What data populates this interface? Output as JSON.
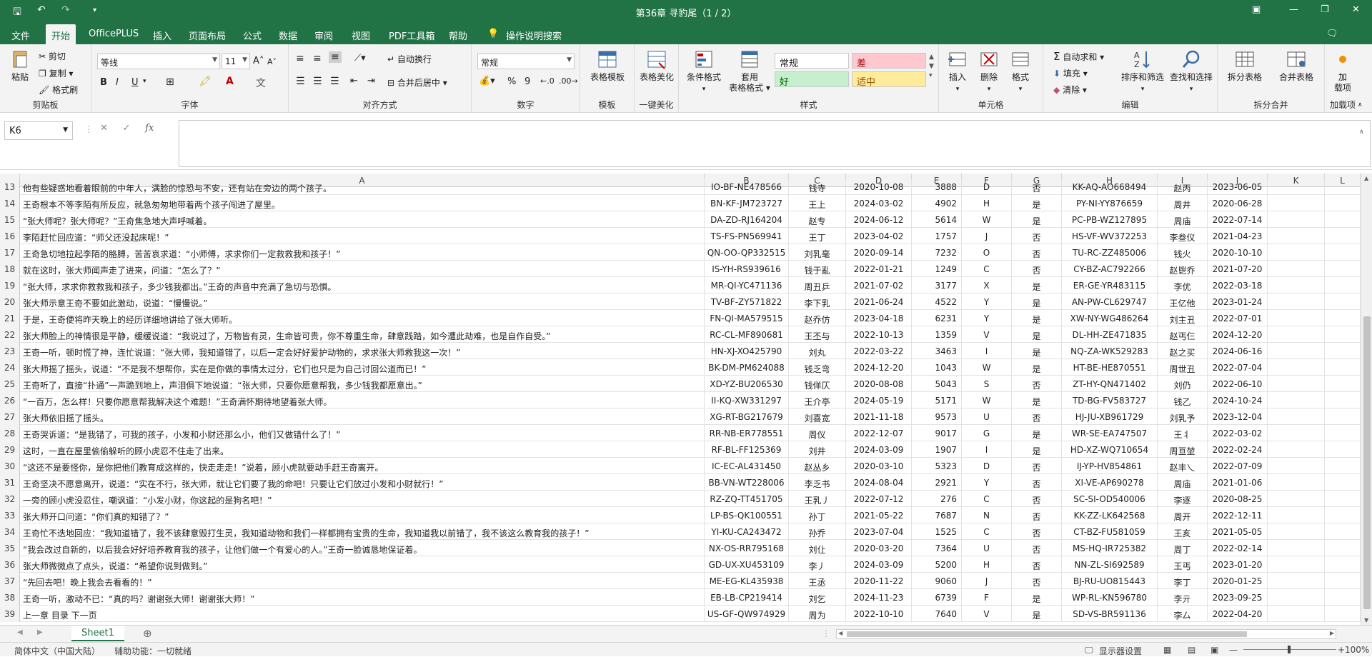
{
  "window": {
    "title": "第36章 寻豹尾（1 / 2）",
    "save_icon": "save-icon",
    "undo_icon": "undo-icon",
    "redo_icon": "redo-icon",
    "customize_icon": "customize-quick-access-icon"
  },
  "menu": {
    "file": "文件",
    "home": "开始",
    "officeplus": "OfficePLUS",
    "insert": "插入",
    "page_layout": "页面布局",
    "formulas": "公式",
    "data": "数据",
    "review": "审阅",
    "view": "视图",
    "pdf": "PDF工具箱",
    "help": "帮助",
    "tell_me": "操作说明搜索"
  },
  "ribbon": {
    "paste": "粘贴",
    "cut": "剪切",
    "copy": "复制",
    "format_painter": "格式刷",
    "clipboard_label": "剪贴板",
    "font_name": "等线",
    "font_size": "11",
    "bold": "B",
    "italic": "I",
    "underline": "U",
    "font_label": "字体",
    "wrap_text": "自动换行",
    "merge_center": "合并后居中",
    "align_label": "对齐方式",
    "number_format": "常规",
    "percent": "%",
    "comma": "9",
    "number_label": "数字",
    "table_template": "表格模板",
    "template_label": "模板",
    "table_beautify": "表格美化",
    "beautify_label": "一键美化",
    "conditional_format": "条件格式",
    "format_as_table_1": "套用",
    "format_as_table_2": "表格格式",
    "style_normal": "常规",
    "style_bad": "差",
    "style_good": "好",
    "style_neutral": "适中",
    "styles_label": "样式",
    "insert": "插入",
    "delete": "删除",
    "format": "格式",
    "cells_label": "单元格",
    "autosum": "自动求和",
    "fill": "填充",
    "clear": "清除",
    "sort_filter": "排序和筛选",
    "find_select": "查找和选择",
    "editing_label": "编辑",
    "split_table": "拆分表格",
    "merge_table": "合并表格",
    "split_merge_label": "拆分合并",
    "addin_1": "加",
    "addin_2": "载项",
    "addins_label": "加载项"
  },
  "formula_bar": {
    "name_box": "K6",
    "fx": "fx",
    "value": ""
  },
  "columns": [
    "A",
    "B",
    "C",
    "D",
    "E",
    "F",
    "G",
    "H",
    "I",
    "J",
    "K",
    "L"
  ],
  "rows": [
    {
      "n": "13",
      "a": "他有些疑惑地看着眼前的中年人，满脸的惊恐与不安，还有站在旁边的两个孩子。",
      "b": "IO-BF-NE478566",
      "c": "钱寺",
      "d": "2020-10-08",
      "e": "3888",
      "f": "D",
      "g": "否",
      "h": "KK-AQ-AO668494",
      "i": "赵丙",
      "j": "2023-06-05"
    },
    {
      "n": "14",
      "a": "王奇根本不等李陌有所反应，就急匆匆地带着两个孩子闯进了屋里。",
      "b": "BN-KF-JM723727",
      "c": "王上",
      "d": "2024-03-02",
      "e": "4902",
      "f": "H",
      "g": "是",
      "h": "PY-NI-YY876659",
      "i": "周井",
      "j": "2020-06-28"
    },
    {
      "n": "15",
      "a": "“张大师呢？张大师呢？”王奇焦急地大声呼喊着。",
      "b": "DA-ZD-RJ164204",
      "c": "赵专",
      "d": "2024-06-12",
      "e": "5614",
      "f": "W",
      "g": "是",
      "h": "PC-PB-WZ127895",
      "i": "周庙",
      "j": "2022-07-14"
    },
    {
      "n": "16",
      "a": "李陌赶忙回应道：“师父还没起床呢！”",
      "b": "TS-FS-PN569941",
      "c": "王丁",
      "d": "2023-04-02",
      "e": "1757",
      "f": "J",
      "g": "否",
      "h": "HS-VF-WV372253",
      "i": "李叁仪",
      "j": "2021-04-23"
    },
    {
      "n": "17",
      "a": "王奇急切地拉起李陌的胳膊，苦苦哀求道：“小师傅，求求你们一定救救我和孩子！”",
      "b": "QN-OO-QP332515",
      "c": "刘乳毫",
      "d": "2020-09-14",
      "e": "7232",
      "f": "O",
      "g": "否",
      "h": "TU-RC-ZZ485006",
      "i": "钱火",
      "j": "2020-10-10"
    },
    {
      "n": "18",
      "a": "就在这时，张大师闻声走了进来，问道：“怎么了？”",
      "b": "IS-YH-RS939616",
      "c": "钱于亂",
      "d": "2022-01-21",
      "e": "1249",
      "f": "C",
      "g": "否",
      "h": "CY-BZ-AC792266",
      "i": "赵鬯乔",
      "j": "2021-07-20"
    },
    {
      "n": "19",
      "a": "“张大师，求求你救救我和孩子，多少钱我都出。”王奇的声音中充满了急切与恐惧。",
      "b": "MR-QI-YC471136",
      "c": "周丑乒",
      "d": "2021-07-02",
      "e": "3177",
      "f": "X",
      "g": "是",
      "h": "ER-GE-YR483115",
      "i": "李优",
      "j": "2022-03-18"
    },
    {
      "n": "20",
      "a": "张大师示意王奇不要如此激动，说道：“慢慢说。”",
      "b": "TV-BF-ZY571822",
      "c": "李下乳",
      "d": "2021-06-24",
      "e": "4522",
      "f": "Y",
      "g": "是",
      "h": "AN-PW-CL629747",
      "i": "王亿他",
      "j": "2023-01-24"
    },
    {
      "n": "21",
      "a": "于是，王奇便将昨天晚上的经历详细地讲给了张大师听。",
      "b": "FN-QI-MA579515",
      "c": "赵乔仿",
      "d": "2023-04-18",
      "e": "6231",
      "f": "Y",
      "g": "是",
      "h": "XW-NY-WG486264",
      "i": "刘主丑",
      "j": "2022-07-01"
    },
    {
      "n": "22",
      "a": "张大师脸上的神情很是平静，缓缓说道：“我说过了，万物皆有灵，生命皆可贵，你不尊重生命，肆意践踏，如今遭此劫难，也是自作自受。”",
      "b": "RC-CL-MF890681",
      "c": "王丕与",
      "d": "2022-10-13",
      "e": "1359",
      "f": "V",
      "g": "是",
      "h": "DL-HH-ZE471835",
      "i": "赵丐仨",
      "j": "2024-12-20"
    },
    {
      "n": "23",
      "a": "王奇一听，顿时慌了神，连忙说道：“张大师，我知道错了，以后一定会好好爱护动物的，求求张大师救我这一次！”",
      "b": "HN-XJ-XO425790",
      "c": "刘丸",
      "d": "2022-03-22",
      "e": "3463",
      "f": "I",
      "g": "是",
      "h": "NQ-ZA-WK529283",
      "i": "赵之买",
      "j": "2024-06-16"
    },
    {
      "n": "24",
      "a": "张大师摇了摇头，说道：“不是我不想帮你，实在是你做的事情太过分，它们也只是为自己讨回公道而已！”",
      "b": "BK-DM-PM624088",
      "c": "钱乏弯",
      "d": "2024-12-20",
      "e": "1043",
      "f": "W",
      "g": "是",
      "h": "HT-BE-HE870551",
      "i": "周世丑",
      "j": "2022-07-04"
    },
    {
      "n": "25",
      "a": "王奇听了，直接“扑通”一声跪到地上，声泪俱下地说道：“张大师，只要你愿意帮我，多少钱我都愿意出。”",
      "b": "XD-YZ-BU206530",
      "c": "钱佯仄",
      "d": "2020-08-08",
      "e": "5043",
      "f": "S",
      "g": "否",
      "h": "ZT-HY-QN471402",
      "i": "刘仍",
      "j": "2022-06-10"
    },
    {
      "n": "26",
      "a": "“一百万，怎么样！只要你愿意帮我解决这个难题！”王奇满怀期待地望着张大师。",
      "b": "II-KQ-XW331297",
      "c": "王介亭",
      "d": "2024-05-19",
      "e": "5171",
      "f": "W",
      "g": "是",
      "h": "TD-BG-FV583727",
      "i": "钱乙",
      "j": "2024-10-24"
    },
    {
      "n": "27",
      "a": "张大师依旧摇了摇头。",
      "b": "XG-RT-BG217679",
      "c": "刘喜宽",
      "d": "2021-11-18",
      "e": "9573",
      "f": "U",
      "g": "否",
      "h": "HJ-JU-XB961729",
      "i": "刘乳予",
      "j": "2023-12-04"
    },
    {
      "n": "28",
      "a": "王奇哭诉道：“是我错了，可我的孩子，小发和小财还那么小，他们又做错什么了！”",
      "b": "RR-NB-ER778551",
      "c": "周仪",
      "d": "2022-12-07",
      "e": "9017",
      "f": "G",
      "g": "是",
      "h": "WR-SE-EA747507",
      "i": "王丬",
      "j": "2022-03-02"
    },
    {
      "n": "29",
      "a": "这时，一直在屋里偷偷躲听的顾小虎忍不住走了出来。",
      "b": "RF-BL-FF125369",
      "c": "刘井",
      "d": "2024-03-09",
      "e": "1907",
      "f": "I",
      "g": "是",
      "h": "HD-XZ-WQ710654",
      "i": "周亘堃",
      "j": "2022-02-24"
    },
    {
      "n": "30",
      "a": "“这还不是要怪你，是你把他们教育成这样的，快走走走！”说着，顾小虎就要动手赶王奇离开。",
      "b": "IC-EC-AL431450",
      "c": "赵丛乡",
      "d": "2020-03-10",
      "e": "5323",
      "f": "D",
      "g": "否",
      "h": "IJ-YP-HV854861",
      "i": "赵丰乀",
      "j": "2022-07-09"
    },
    {
      "n": "31",
      "a": "王奇坚决不愿意离开，说道：“实在不行，张大师，就让它们要了我的命吧！只要让它们放过小发和小财就行！”",
      "b": "BB-VN-WT228006",
      "c": "李乏书",
      "d": "2024-08-04",
      "e": "2921",
      "f": "Y",
      "g": "否",
      "h": "XI-VE-AP690278",
      "i": "周庙",
      "j": "2021-01-06"
    },
    {
      "n": "32",
      "a": "一旁的顾小虎没忍住，嘲讽道：“小发小财，你这起的是狗名吧！”",
      "b": "RZ-ZQ-TT451705",
      "c": "王乳丿",
      "d": "2022-07-12",
      "e": "276",
      "f": "C",
      "g": "否",
      "h": "SC-SI-OD540006",
      "i": "李逐",
      "j": "2020-08-25"
    },
    {
      "n": "33",
      "a": "张大师开口问道：“你们真的知错了？”",
      "b": "LP-BS-QK100551",
      "c": "孙丁",
      "d": "2021-05-22",
      "e": "7687",
      "f": "N",
      "g": "否",
      "h": "KK-ZZ-LK642568",
      "i": "周开",
      "j": "2022-12-11"
    },
    {
      "n": "34",
      "a": "王奇忙不迭地回应：“我知道错了，我不该肆意毁打生灵，我知道动物和我们一样都拥有宝贵的生命，我知道我以前错了，我不该这么教育我的孩子！”",
      "b": "YI-KU-CA243472",
      "c": "孙乔",
      "d": "2023-07-04",
      "e": "1525",
      "f": "C",
      "g": "否",
      "h": "CT-BZ-FU581059",
      "i": "王亥",
      "j": "2021-05-05"
    },
    {
      "n": "35",
      "a": "“我会改过自新的，以后我会好好培养教育我的孩子，让他们做一个有爱心的人。”王奇一脸诚恳地保证着。",
      "b": "NX-OS-RR795168",
      "c": "刘仩",
      "d": "2020-03-20",
      "e": "7364",
      "f": "U",
      "g": "否",
      "h": "MS-HQ-IR725382",
      "i": "周丁",
      "j": "2022-02-14"
    },
    {
      "n": "36",
      "a": "张大师微微点了点头，说道：“希望你说到做到。”",
      "b": "GD-UX-XU453109",
      "c": "李丿",
      "d": "2024-03-09",
      "e": "5200",
      "f": "H",
      "g": "否",
      "h": "NN-ZL-SI692589",
      "i": "王丐",
      "j": "2023-01-20"
    },
    {
      "n": "37",
      "a": "“先回去吧！晚上我会去看看的！”",
      "b": "ME-EG-KL435938",
      "c": "王丞",
      "d": "2020-11-22",
      "e": "9060",
      "f": "J",
      "g": "否",
      "h": "BJ-RU-UO815443",
      "i": "李丁",
      "j": "2020-01-25"
    },
    {
      "n": "38",
      "a": "王奇一听，激动不已：“真的吗？谢谢张大师！谢谢张大师！”",
      "b": "EB-LB-CP219414",
      "c": "刘乞",
      "d": "2024-11-23",
      "e": "6739",
      "f": "F",
      "g": "是",
      "h": "WP-RL-KN596780",
      "i": "李亓",
      "j": "2023-09-25"
    },
    {
      "n": "39",
      "a": "上一章 目录 下一页",
      "b": "US-GF-QW974929",
      "c": "周为",
      "d": "2022-10-10",
      "e": "7640",
      "f": "V",
      "g": "是",
      "h": "SD-VS-BR591136",
      "i": "李厶",
      "j": "2022-04-20"
    }
  ],
  "sheets": {
    "active": "Sheet1",
    "add_icon": "add-sheet-icon"
  },
  "status": {
    "language": "简体中文（中国大陆）",
    "accessibility": "辅助功能：一切就绪",
    "display_settings": "显示器设置",
    "zoom": "100%"
  },
  "colors": {
    "accent": "#217346",
    "bad_fill": "#FFC7CE",
    "good_fill": "#C6EFCE",
    "neutral_fill": "#FFEB9C"
  }
}
